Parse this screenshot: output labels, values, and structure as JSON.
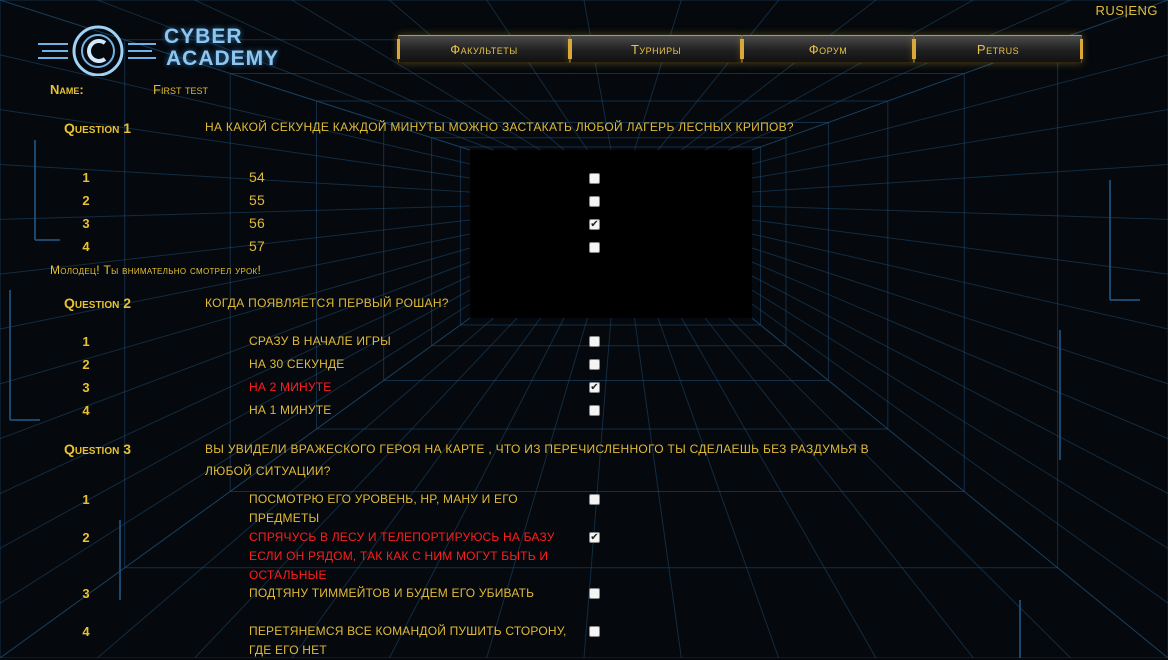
{
  "lang": {
    "ru": "RUS",
    "sep": "|",
    "en": "ENG"
  },
  "logo": {
    "line1": "CYBER",
    "line2": "ACADEMY"
  },
  "nav": [
    {
      "label": "Факультеты"
    },
    {
      "label": "Турниры"
    },
    {
      "label": "Форум"
    },
    {
      "label": "Petrus"
    }
  ],
  "test": {
    "name_label": "Name:",
    "name_value": "First test"
  },
  "questions": [
    {
      "label": "Question 1",
      "text": "на какой секунде каждой минуты можно застакать любой лагерь лесных крипов?",
      "options": [
        {
          "num": "1",
          "text": "54",
          "checked": false
        },
        {
          "num": "2",
          "text": "55",
          "checked": false
        },
        {
          "num": "3",
          "text": "56",
          "checked": true
        },
        {
          "num": "4",
          "text": "57",
          "checked": false
        }
      ],
      "feedback": "Молодец! Ты внимательно смотрел урок!"
    },
    {
      "label": "Question 2",
      "text": "Когда появляется первый Рошан?",
      "options": [
        {
          "num": "1",
          "text": "сразу в начале игры",
          "checked": false
        },
        {
          "num": "2",
          "text": "на 30 секунде",
          "checked": false
        },
        {
          "num": "3",
          "text": "на 2 минуте",
          "checked": true
        },
        {
          "num": "4",
          "text": "на 1 минуте",
          "checked": false
        }
      ]
    },
    {
      "label": "Question 3",
      "text": "Вы увидели вражеского героя на карте , что из перечисленного ты сделаешь без раздумья в любой ситуации?",
      "options": [
        {
          "num": "1",
          "text": "посмотрю его уровень, HP, ману и его предметы",
          "checked": false
        },
        {
          "num": "2",
          "text": "спрячусь в лесу и телепортируюсь на базу если он рядом, так как с ним могут быть и остальные",
          "checked": true
        },
        {
          "num": "3",
          "text": "подтяну тиммейтов и будем его убивать",
          "checked": false
        },
        {
          "num": "4",
          "text": "перетянемся все командой пушить сторону, где его нет",
          "checked": false
        }
      ]
    }
  ],
  "colors": {
    "accent": "#e0ba38",
    "wrong": "#ff1e1e",
    "grid": "#1f4f78"
  }
}
